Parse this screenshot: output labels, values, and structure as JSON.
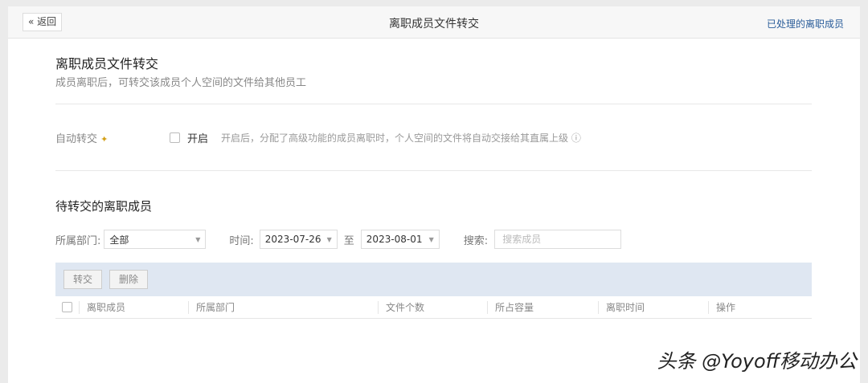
{
  "header": {
    "back_label": "« 返回",
    "title": "离职成员文件转交",
    "processed_link": "已处理的离职成员"
  },
  "intro": {
    "title": "离职成员文件转交",
    "subtitle": "成员离职后，可转交该成员个人空间的文件给其他员工"
  },
  "auto_transfer": {
    "label": "自动转交",
    "enable_label": "开启",
    "checked": false,
    "description": "开启后，分配了高级功能的成员离职时，个人空间的文件将自动交接给其直属上级 ⓘ"
  },
  "pending": {
    "title": "待转交的离职成员"
  },
  "filters": {
    "dept_label": "所属部门:",
    "dept_value": "全部",
    "time_label": "时间:",
    "start_date": "2023-07-26",
    "to_label": "至",
    "end_date": "2023-08-01",
    "search_label": "搜索:",
    "search_placeholder": "搜索成员",
    "search_value": ""
  },
  "toolbar": {
    "transfer": "转交",
    "delete": "删除"
  },
  "table": {
    "columns": [
      "离职成员",
      "所属部门",
      "文件个数",
      "所占容量",
      "离职时间",
      "操作"
    ]
  },
  "watermark": "头条 @Yoyoff移动办公"
}
